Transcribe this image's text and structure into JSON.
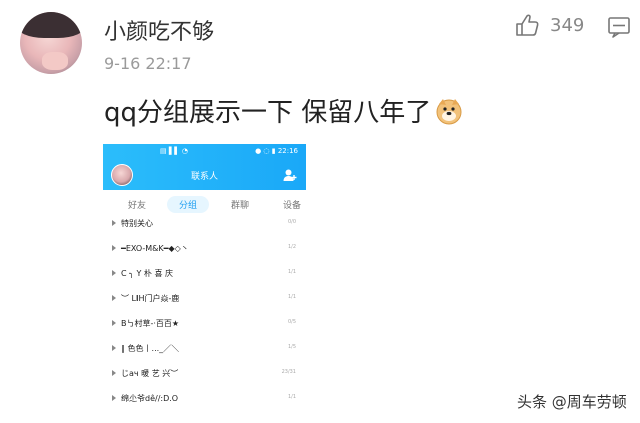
{
  "comment": {
    "username": "小颜吃不够",
    "timestamp": "9-16 22:17",
    "like_count": "349",
    "text": "qq分组展示一下 保留八年了",
    "icons": {
      "like": "thumbs-up-icon",
      "reply": "reply-icon",
      "emoji": "doge-emoji"
    }
  },
  "phone": {
    "status": {
      "left": "",
      "middle": "",
      "time": "22:16"
    },
    "title": "联系人",
    "tabs": [
      {
        "label": "好友"
      },
      {
        "label": "分组",
        "active": true
      },
      {
        "label": "群聊"
      },
      {
        "label": "设备"
      }
    ],
    "groups": [
      {
        "name": "特别关心",
        "count": "0/0"
      },
      {
        "name": "━EXO-M&K━◆◇丶",
        "count": "1/2"
      },
      {
        "name": "C ╮ Y 朴 喜 庆",
        "count": "1/1"
      },
      {
        "name": "︶ L𝐈H门户焱-鹿",
        "count": "1/1"
      },
      {
        "name": "B㇉村草-·百百★",
        "count": "0/5"
      },
      {
        "name": "∥ 色色丨..._／＼",
        "count": "1/5"
      },
      {
        "name": "じaч 暖 艺 兴︶",
        "count": "23/31"
      },
      {
        "name": "绵尐爷dê//:D.O",
        "count": "1/1"
      }
    ]
  },
  "watermark": "头条 @周车劳顿",
  "colors": {
    "accent": "#1aa8f8",
    "meta": "#9a9a9a"
  }
}
